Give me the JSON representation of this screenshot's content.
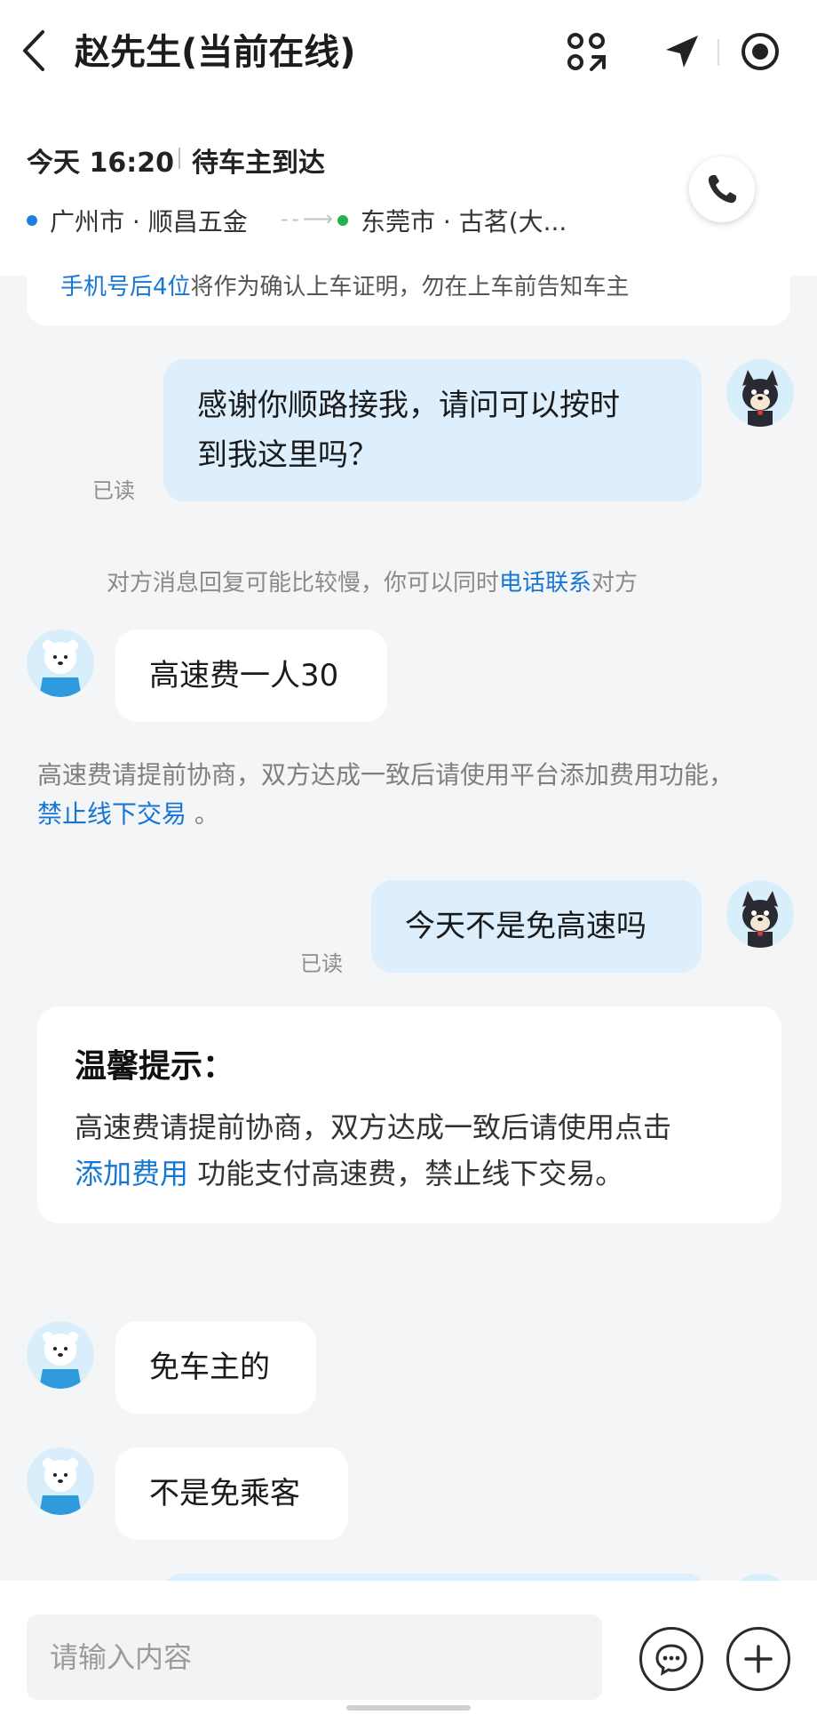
{
  "header": {
    "title": "赵先生(当前在线)",
    "icons": [
      "back-chevron-icon",
      "scan-code-icon",
      "navigation-arrow-icon",
      "record-target-icon"
    ]
  },
  "trip": {
    "time": "今天 16:20",
    "status": "待车主到达",
    "from": "广州市 · 顺昌五金",
    "to": "东莞市 · 古茗(大...",
    "from_dot_color": "#1e7fe0",
    "to_dot_color": "#22b14c"
  },
  "chat": {
    "notice_highlight": "手机号后4位",
    "notice_rest": "将作为确认上车证明，勿在上车前告知车主",
    "msg1": {
      "line1": "感谢你顺路接我，请问可以按时",
      "line2": "到我这里吗？",
      "read": "已读"
    },
    "sys_prefix": "对方消息回复可能比较慢，你可以同时",
    "sys_link": "电话联系",
    "sys_suffix": "对方",
    "msg2": "高速费一人30",
    "warn_text": "高速费请提前协商，双方达成一致后请使用平台添加费用功能，",
    "warn_link": "禁止线下交易",
    "warn_end": "。",
    "msg3": {
      "text": "今天不是免高速吗",
      "read": "已读"
    },
    "tip": {
      "title": "温馨提示：",
      "body_start": "高速费请提前协商，双方达成一致后请使用点击",
      "body_link": "添加费用",
      "body_end": " 功能支付高速费，禁止线下交易。"
    },
    "msg4": "免车主的",
    "msg5": "不是免乘客"
  },
  "input": {
    "placeholder": "请输入内容"
  },
  "colors": {
    "accent": "#1677d2",
    "my_bubble": "#ddeefc",
    "background": "#f4f5f7"
  }
}
